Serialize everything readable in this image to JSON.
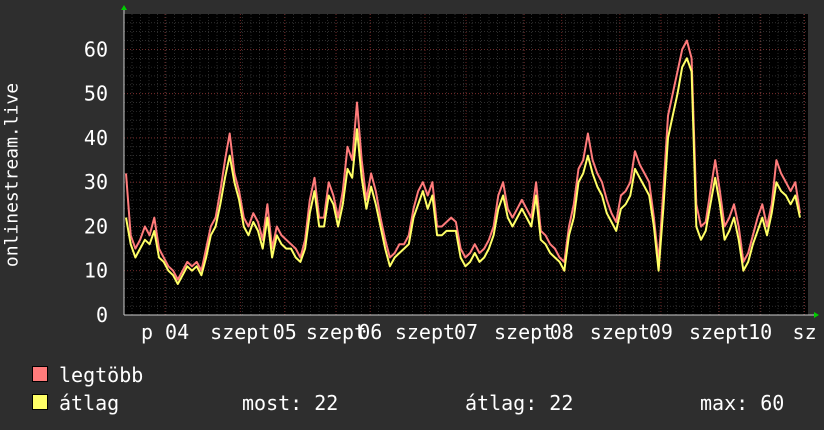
{
  "chart_data": {
    "type": "line",
    "ylabel": "onlinestream.live",
    "ylim": [
      0,
      68
    ],
    "yticks": [
      0,
      10,
      20,
      30,
      40,
      50,
      60
    ],
    "xticks": [
      {
        "label": "p 04",
        "pos": 0.06
      },
      {
        "label": "szept",
        "pos": 0.17
      },
      {
        "label": "05",
        "pos": 0.235
      },
      {
        "label": "szept",
        "pos": 0.31
      },
      {
        "label": "06",
        "pos": 0.36
      },
      {
        "label": "szept",
        "pos": 0.44
      },
      {
        "label": "07",
        "pos": 0.5
      },
      {
        "label": "szept",
        "pos": 0.585
      },
      {
        "label": "08",
        "pos": 0.64
      },
      {
        "label": "szept",
        "pos": 0.725
      },
      {
        "label": "09",
        "pos": 0.785
      },
      {
        "label": "szept",
        "pos": 0.87
      },
      {
        "label": "10",
        "pos": 0.93
      },
      {
        "label": "sz",
        "pos": 0.995
      }
    ],
    "grid": true,
    "series": [
      {
        "name": "legtöbb",
        "color": "#ff7b7b",
        "values": [
          32,
          18,
          15,
          17,
          20,
          18,
          22,
          15,
          13,
          11,
          10,
          8,
          10,
          12,
          11,
          12,
          10,
          15,
          20,
          22,
          28,
          35,
          41,
          32,
          28,
          22,
          20,
          23,
          21,
          17,
          25,
          15,
          20,
          18,
          17,
          16,
          15,
          13,
          17,
          26,
          31,
          22,
          22,
          30,
          27,
          22,
          28,
          38,
          35,
          48,
          35,
          26,
          32,
          28,
          22,
          17,
          13,
          14,
          16,
          16,
          18,
          24,
          28,
          30,
          27,
          30,
          20,
          20,
          21,
          22,
          21,
          15,
          13,
          14,
          16,
          14,
          15,
          17,
          20,
          27,
          30,
          24,
          22,
          24,
          26,
          24,
          22,
          30,
          19,
          18,
          16,
          15,
          13,
          12,
          20,
          25,
          33,
          35,
          41,
          35,
          32,
          30,
          26,
          23,
          21,
          27,
          28,
          30,
          37,
          34,
          32,
          30,
          22,
          12,
          28,
          45,
          50,
          55,
          60,
          62,
          58,
          25,
          20,
          21,
          28,
          35,
          28,
          20,
          22,
          25,
          20,
          12,
          14,
          18,
          22,
          25,
          20,
          25,
          35,
          32,
          30,
          28,
          30,
          23
        ]
      },
      {
        "name": "átlag",
        "color": "#ffff66",
        "values": [
          22,
          16,
          13,
          15,
          17,
          16,
          19,
          13,
          12,
          10,
          9,
          7,
          9,
          11,
          10,
          11,
          9,
          13,
          18,
          20,
          25,
          31,
          36,
          30,
          26,
          20,
          18,
          21,
          19,
          15,
          22,
          13,
          18,
          16,
          15,
          15,
          13,
          12,
          15,
          23,
          28,
          20,
          20,
          27,
          25,
          20,
          25,
          33,
          31,
          42,
          31,
          24,
          29,
          25,
          20,
          15,
          11,
          13,
          14,
          15,
          16,
          22,
          25,
          28,
          24,
          27,
          18,
          18,
          19,
          19,
          19,
          13,
          11,
          12,
          14,
          12,
          13,
          15,
          18,
          24,
          27,
          22,
          20,
          22,
          24,
          22,
          20,
          27,
          17,
          16,
          14,
          13,
          12,
          10,
          18,
          22,
          30,
          32,
          36,
          32,
          29,
          27,
          23,
          21,
          19,
          24,
          25,
          27,
          33,
          31,
          29,
          27,
          20,
          10,
          24,
          40,
          45,
          50,
          56,
          58,
          55,
          20,
          17,
          19,
          25,
          31,
          25,
          17,
          19,
          22,
          17,
          10,
          12,
          16,
          19,
          22,
          18,
          23,
          30,
          28,
          27,
          25,
          27,
          22
        ]
      }
    ]
  },
  "legend": [
    {
      "label": "legtöbb",
      "color": "#ff7b7b"
    },
    {
      "label": "átlag",
      "color": "#ffff66"
    }
  ],
  "stats": {
    "now": "most: 22",
    "avg": "átlag: 22",
    "max": "max: 60"
  }
}
